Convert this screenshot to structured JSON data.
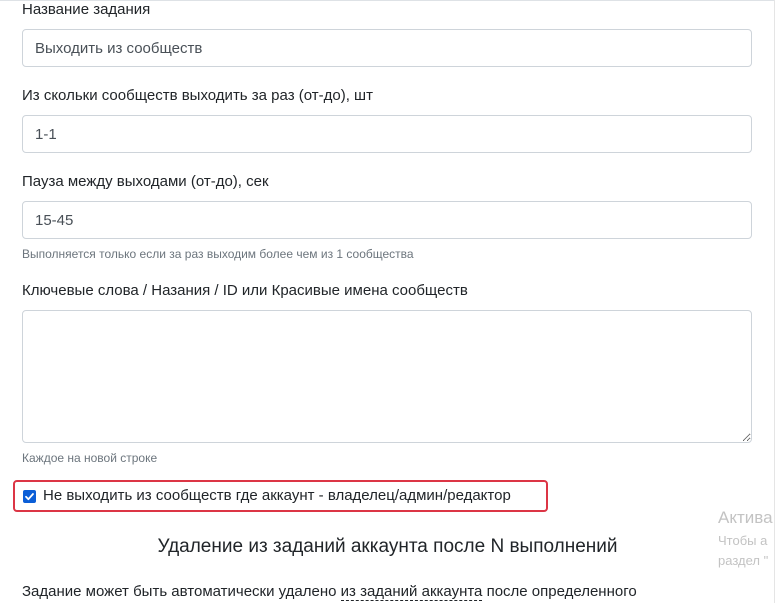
{
  "form": {
    "task_name": {
      "label": "Название задания",
      "value": "Выходить из сообществ"
    },
    "per_run": {
      "label": "Из скольки сообществ выходить за раз (от-до), шт",
      "value": "1-1"
    },
    "pause": {
      "label": "Пауза между выходами (от-до), сек",
      "value": "15-45",
      "help": "Выполняется только если за раз выходим более чем из 1 сообщества"
    },
    "keywords": {
      "label": "Ключевые слова / Назания / ID или Красивые имена сообществ",
      "value": "",
      "help": "Каждое на новой строке"
    },
    "skip_owned": {
      "label": "Не выходить из сообществ где аккаунт - владелец/админ/редактор",
      "checked": true
    }
  },
  "section": {
    "title": "Удаление из заданий аккаунта после N выполнений",
    "text_before": "Задание может быть автоматически удалено ",
    "link": "из заданий аккаунта",
    "text_after": " после определенного"
  },
  "watermark": {
    "title": "Актива",
    "line1": "Чтобы а",
    "line2": "раздел \""
  },
  "colors": {
    "highlight_border": "#dc3545",
    "checkbox_accent": "#0b5ed7"
  }
}
